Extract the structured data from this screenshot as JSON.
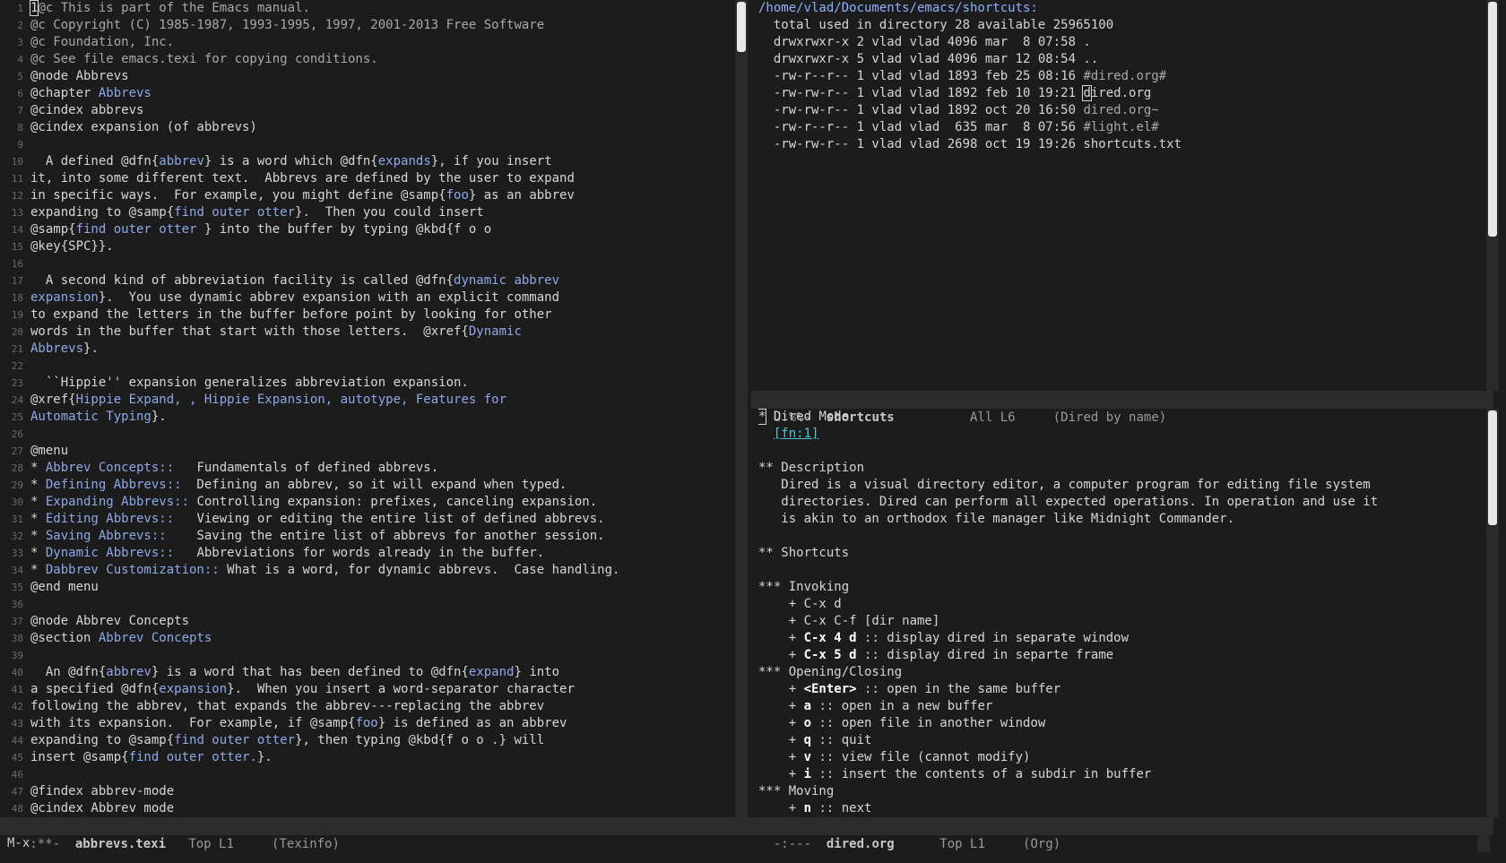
{
  "left_window": {
    "lines": [
      {
        "n": "1",
        "segs": [
          {
            "t": "1",
            "cls": "cursorchar"
          },
          {
            "t": "@c This is part of the Emacs manual.",
            "cls": "dim"
          }
        ]
      },
      {
        "n": "2",
        "segs": [
          {
            "t": "@c Copyright (C) 1985-1987, 1993-1995, 1997, 2001-2013 Free Software",
            "cls": "dim"
          }
        ]
      },
      {
        "n": "3",
        "segs": [
          {
            "t": "@c Foundation, Inc.",
            "cls": "dim"
          }
        ]
      },
      {
        "n": "4",
        "segs": [
          {
            "t": "@c See file emacs.texi for copying conditions.",
            "cls": "dim"
          }
        ]
      },
      {
        "n": "5",
        "segs": [
          {
            "t": "@node Abbrevs",
            "cls": "kw"
          }
        ]
      },
      {
        "n": "6",
        "segs": [
          {
            "t": "@chapter ",
            "cls": "kw"
          },
          {
            "t": "Abbrevs",
            "cls": "arg"
          }
        ]
      },
      {
        "n": "7",
        "segs": [
          {
            "t": "@cindex abbrevs",
            "cls": "kw"
          }
        ]
      },
      {
        "n": "8",
        "segs": [
          {
            "t": "@cindex expansion (of abbrevs)",
            "cls": "kw"
          }
        ]
      },
      {
        "n": "9",
        "segs": []
      },
      {
        "n": "10",
        "segs": [
          {
            "t": "  A defined @dfn{",
            "cls": "kw"
          },
          {
            "t": "abbrev",
            "cls": "arg"
          },
          {
            "t": "} is a word which @dfn{",
            "cls": "kw"
          },
          {
            "t": "expands",
            "cls": "arg"
          },
          {
            "t": "}, if you insert",
            "cls": "kw"
          }
        ]
      },
      {
        "n": "11",
        "segs": [
          {
            "t": "it, into some different text.  Abbrevs are defined by the user to expand",
            "cls": "kw"
          }
        ]
      },
      {
        "n": "12",
        "segs": [
          {
            "t": "in specific ways.  For example, you might define @samp{",
            "cls": "kw"
          },
          {
            "t": "foo",
            "cls": "arg"
          },
          {
            "t": "} as an abbrev",
            "cls": "kw"
          }
        ]
      },
      {
        "n": "13",
        "segs": [
          {
            "t": "expanding to @samp{",
            "cls": "kw"
          },
          {
            "t": "find outer otter",
            "cls": "arg"
          },
          {
            "t": "}.  Then you could insert",
            "cls": "kw"
          }
        ]
      },
      {
        "n": "14",
        "segs": [
          {
            "t": "@samp{",
            "cls": "kw"
          },
          {
            "t": "find outer otter ",
            "cls": "arg"
          },
          {
            "t": "} into the buffer by typing @kbd{f o o",
            "cls": "kw"
          }
        ]
      },
      {
        "n": "15",
        "segs": [
          {
            "t": "@key{SPC}}.",
            "cls": "kw"
          }
        ]
      },
      {
        "n": "16",
        "segs": []
      },
      {
        "n": "17",
        "segs": [
          {
            "t": "  A second kind of abbreviation facility is called @dfn{",
            "cls": "kw"
          },
          {
            "t": "dynamic abbrev",
            "cls": "arg"
          }
        ]
      },
      {
        "n": "18",
        "segs": [
          {
            "t": "expansion",
            "cls": "arg"
          },
          {
            "t": "}.  You use dynamic abbrev expansion with an explicit command",
            "cls": "kw"
          }
        ]
      },
      {
        "n": "19",
        "segs": [
          {
            "t": "to expand the letters in the buffer before point by looking for other",
            "cls": "kw"
          }
        ]
      },
      {
        "n": "20",
        "segs": [
          {
            "t": "words in the buffer that start with those letters.  @xref{",
            "cls": "kw"
          },
          {
            "t": "Dynamic",
            "cls": "arg"
          }
        ]
      },
      {
        "n": "21",
        "segs": [
          {
            "t": "Abbrevs",
            "cls": "arg"
          },
          {
            "t": "}.",
            "cls": "kw"
          }
        ]
      },
      {
        "n": "22",
        "segs": []
      },
      {
        "n": "23",
        "segs": [
          {
            "t": "  ``Hippie'' expansion generalizes abbreviation expansion.",
            "cls": "kw"
          }
        ]
      },
      {
        "n": "24",
        "segs": [
          {
            "t": "@xref{",
            "cls": "kw"
          },
          {
            "t": "Hippie Expand, , Hippie Expansion, autotype, Features for",
            "cls": "arg"
          }
        ]
      },
      {
        "n": "25",
        "segs": [
          {
            "t": "Automatic Typing",
            "cls": "arg"
          },
          {
            "t": "}.",
            "cls": "kw"
          }
        ]
      },
      {
        "n": "26",
        "segs": []
      },
      {
        "n": "27",
        "segs": [
          {
            "t": "@menu",
            "cls": "kw"
          }
        ]
      },
      {
        "n": "28",
        "segs": [
          {
            "t": "* ",
            "cls": "kw"
          },
          {
            "t": "Abbrev Concepts::",
            "cls": "arg"
          },
          {
            "t": "   Fundamentals of defined abbrevs.",
            "cls": "kw"
          }
        ]
      },
      {
        "n": "29",
        "segs": [
          {
            "t": "* ",
            "cls": "kw"
          },
          {
            "t": "Defining Abbrevs::",
            "cls": "arg"
          },
          {
            "t": "  Defining an abbrev, so it will expand when typed.",
            "cls": "kw"
          }
        ]
      },
      {
        "n": "30",
        "segs": [
          {
            "t": "* ",
            "cls": "kw"
          },
          {
            "t": "Expanding Abbrevs::",
            "cls": "arg"
          },
          {
            "t": " Controlling expansion: prefixes, canceling expansion.",
            "cls": "kw"
          }
        ]
      },
      {
        "n": "31",
        "segs": [
          {
            "t": "* ",
            "cls": "kw"
          },
          {
            "t": "Editing Abbrevs::",
            "cls": "arg"
          },
          {
            "t": "   Viewing or editing the entire list of defined abbrevs.",
            "cls": "kw"
          }
        ]
      },
      {
        "n": "32",
        "segs": [
          {
            "t": "* ",
            "cls": "kw"
          },
          {
            "t": "Saving Abbrevs::",
            "cls": "arg"
          },
          {
            "t": "    Saving the entire list of abbrevs for another session.",
            "cls": "kw"
          }
        ]
      },
      {
        "n": "33",
        "segs": [
          {
            "t": "* ",
            "cls": "kw"
          },
          {
            "t": "Dynamic Abbrevs::",
            "cls": "arg"
          },
          {
            "t": "   Abbreviations for words already in the buffer.",
            "cls": "kw"
          }
        ]
      },
      {
        "n": "34",
        "segs": [
          {
            "t": "* ",
            "cls": "kw"
          },
          {
            "t": "Dabbrev Customization::",
            "cls": "arg"
          },
          {
            "t": " What is a word, for dynamic abbrevs.  Case handling.",
            "cls": "kw"
          }
        ]
      },
      {
        "n": "35",
        "segs": [
          {
            "t": "@end menu",
            "cls": "kw"
          }
        ]
      },
      {
        "n": "36",
        "segs": []
      },
      {
        "n": "37",
        "segs": [
          {
            "t": "@node Abbrev Concepts",
            "cls": "kw"
          }
        ]
      },
      {
        "n": "38",
        "segs": [
          {
            "t": "@section ",
            "cls": "kw"
          },
          {
            "t": "Abbrev Concepts",
            "cls": "arg"
          }
        ]
      },
      {
        "n": "39",
        "segs": []
      },
      {
        "n": "40",
        "segs": [
          {
            "t": "  An @dfn{",
            "cls": "kw"
          },
          {
            "t": "abbrev",
            "cls": "arg"
          },
          {
            "t": "} is a word that has been defined to @dfn{",
            "cls": "kw"
          },
          {
            "t": "expand",
            "cls": "arg"
          },
          {
            "t": "} into",
            "cls": "kw"
          }
        ]
      },
      {
        "n": "41",
        "segs": [
          {
            "t": "a specified @dfn{",
            "cls": "kw"
          },
          {
            "t": "expansion",
            "cls": "arg"
          },
          {
            "t": "}.  When you insert a word-separator character",
            "cls": "kw"
          }
        ]
      },
      {
        "n": "42",
        "segs": [
          {
            "t": "following the abbrev, that expands the abbrev---replacing the abbrev",
            "cls": "kw"
          }
        ]
      },
      {
        "n": "43",
        "segs": [
          {
            "t": "with its expansion.  For example, if @samp{",
            "cls": "kw"
          },
          {
            "t": "foo",
            "cls": "arg"
          },
          {
            "t": "} is defined as an abbrev",
            "cls": "kw"
          }
        ]
      },
      {
        "n": "44",
        "segs": [
          {
            "t": "expanding to @samp{",
            "cls": "kw"
          },
          {
            "t": "find outer otter",
            "cls": "arg"
          },
          {
            "t": "}, then typing @kbd{f o o .} will",
            "cls": "kw"
          }
        ]
      },
      {
        "n": "45",
        "segs": [
          {
            "t": "insert @samp{",
            "cls": "kw"
          },
          {
            "t": "find outer otter.",
            "cls": "arg"
          },
          {
            "t": "}.",
            "cls": "kw"
          }
        ]
      },
      {
        "n": "46",
        "segs": []
      },
      {
        "n": "47",
        "segs": [
          {
            "t": "@findex abbrev-mode",
            "cls": "kw"
          }
        ]
      },
      {
        "n": "48",
        "segs": [
          {
            "t": "@cindex Abbrev mode",
            "cls": "kw"
          }
        ]
      }
    ],
    "modeline": {
      "flags": "-:**-  ",
      "buffer": "abbrevs.texi",
      "pos": "   Top L1     ",
      "mode": "(Texinfo)"
    }
  },
  "dired_window": {
    "lines": [
      [
        {
          "t": "/home/vlad/Documents/emacs/shortcuts:",
          "cls": "path"
        }
      ],
      [
        {
          "t": "  total used in directory 28 available 25965100",
          "cls": "kw"
        }
      ],
      [
        {
          "t": "  drwxrwxr-x 2 vlad vlad 4096 mar  8 07:58 .",
          "cls": "kw"
        }
      ],
      [
        {
          "t": "  drwxrwxr-x 5 vlad vlad 4096 mar 12 08:54 ..",
          "cls": "kw"
        }
      ],
      [
        {
          "t": "  -rw-r--r-- 1 vlad vlad 1893 feb 25 08:16 ",
          "cls": "kw"
        },
        {
          "t": "#dired.org#",
          "cls": "dim"
        }
      ],
      [
        {
          "t": "  -rw-rw-r-- 1 vlad vlad 1892 feb 10 19:21 ",
          "cls": "kw"
        },
        {
          "t": "d",
          "cls": "cursorchar"
        },
        {
          "t": "ired.org",
          "cls": "kw"
        }
      ],
      [
        {
          "t": "  -rw-rw-r-- 1 vlad vlad 1892 oct 20 16:50 ",
          "cls": "kw"
        },
        {
          "t": "dired.org~",
          "cls": "dim"
        }
      ],
      [
        {
          "t": "  -rw-r--r-- 1 vlad vlad  635 mar  8 07:56 ",
          "cls": "kw"
        },
        {
          "t": "#light.el#",
          "cls": "dim"
        }
      ],
      [
        {
          "t": "  -rw-rw-r-- 1 vlad vlad 2698 oct 19 19:26 shortcuts.txt",
          "cls": "kw"
        }
      ]
    ],
    "modeline": {
      "flags": "U:%%-  ",
      "buffer": "shortcuts",
      "pos": "          All L6     ",
      "mode": "(Dired by name)"
    }
  },
  "org_window": {
    "lines": [
      [
        {
          "t": "*",
          "cls": "cursorchar"
        },
        {
          "t": " Dired Mode",
          "cls": "kw"
        }
      ],
      [
        {
          "t": "  ",
          "cls": "kw"
        },
        {
          "t": "[fn:1]",
          "cls": "link"
        }
      ],
      [],
      [
        {
          "t": "** Description",
          "cls": "kw"
        }
      ],
      [
        {
          "t": "   Dired is a visual directory editor, a computer program for editing file system",
          "cls": "kw"
        }
      ],
      [
        {
          "t": "   directories. Dired can perform all expected operations. In operation and use it",
          "cls": "kw"
        }
      ],
      [
        {
          "t": "   is akin to an orthodox file manager like Midnight Commander.",
          "cls": "kw"
        }
      ],
      [],
      [
        {
          "t": "** Shortcuts",
          "cls": "kw"
        }
      ],
      [],
      [
        {
          "t": "*** Invoking",
          "cls": "kw"
        }
      ],
      [
        {
          "t": "    + C-x d",
          "cls": "kw"
        }
      ],
      [
        {
          "t": "    + C-x C-f [dir name]",
          "cls": "kw"
        }
      ],
      [
        {
          "t": "    + ",
          "cls": "kw"
        },
        {
          "t": "C-x 4 d",
          "cls": "bold"
        },
        {
          "t": " :: display dired in separate window",
          "cls": "kw"
        }
      ],
      [
        {
          "t": "    + ",
          "cls": "kw"
        },
        {
          "t": "C-x 5 d",
          "cls": "bold"
        },
        {
          "t": " :: display dired in separte frame",
          "cls": "kw"
        }
      ],
      [
        {
          "t": "*** Opening/Closing",
          "cls": "kw"
        }
      ],
      [
        {
          "t": "    + ",
          "cls": "kw"
        },
        {
          "t": "<Enter>",
          "cls": "bold"
        },
        {
          "t": " :: open in the same buffer",
          "cls": "kw"
        }
      ],
      [
        {
          "t": "    + ",
          "cls": "kw"
        },
        {
          "t": "a",
          "cls": "bold"
        },
        {
          "t": " :: open in a new buffer",
          "cls": "kw"
        }
      ],
      [
        {
          "t": "    + ",
          "cls": "kw"
        },
        {
          "t": "o",
          "cls": "bold"
        },
        {
          "t": " :: open file in another window",
          "cls": "kw"
        }
      ],
      [
        {
          "t": "    + ",
          "cls": "kw"
        },
        {
          "t": "q",
          "cls": "bold"
        },
        {
          "t": " :: quit",
          "cls": "kw"
        }
      ],
      [
        {
          "t": "    + ",
          "cls": "kw"
        },
        {
          "t": "v",
          "cls": "bold"
        },
        {
          "t": " :: view file (cannot modify)",
          "cls": "kw"
        }
      ],
      [
        {
          "t": "    + ",
          "cls": "kw"
        },
        {
          "t": "i",
          "cls": "bold"
        },
        {
          "t": " :: insert the contents of a subdir in buffer",
          "cls": "kw"
        }
      ],
      [
        {
          "t": "*** Moving",
          "cls": "kw"
        }
      ],
      [
        {
          "t": "    + ",
          "cls": "kw"
        },
        {
          "t": "n",
          "cls": "bold"
        },
        {
          "t": " :: next",
          "cls": "kw"
        }
      ]
    ],
    "modeline": {
      "flags": "-:---  ",
      "buffer": "dired.org",
      "pos": "      Top L1     ",
      "mode": "(Org)"
    }
  },
  "minibuffer": {
    "text": "M-x"
  }
}
